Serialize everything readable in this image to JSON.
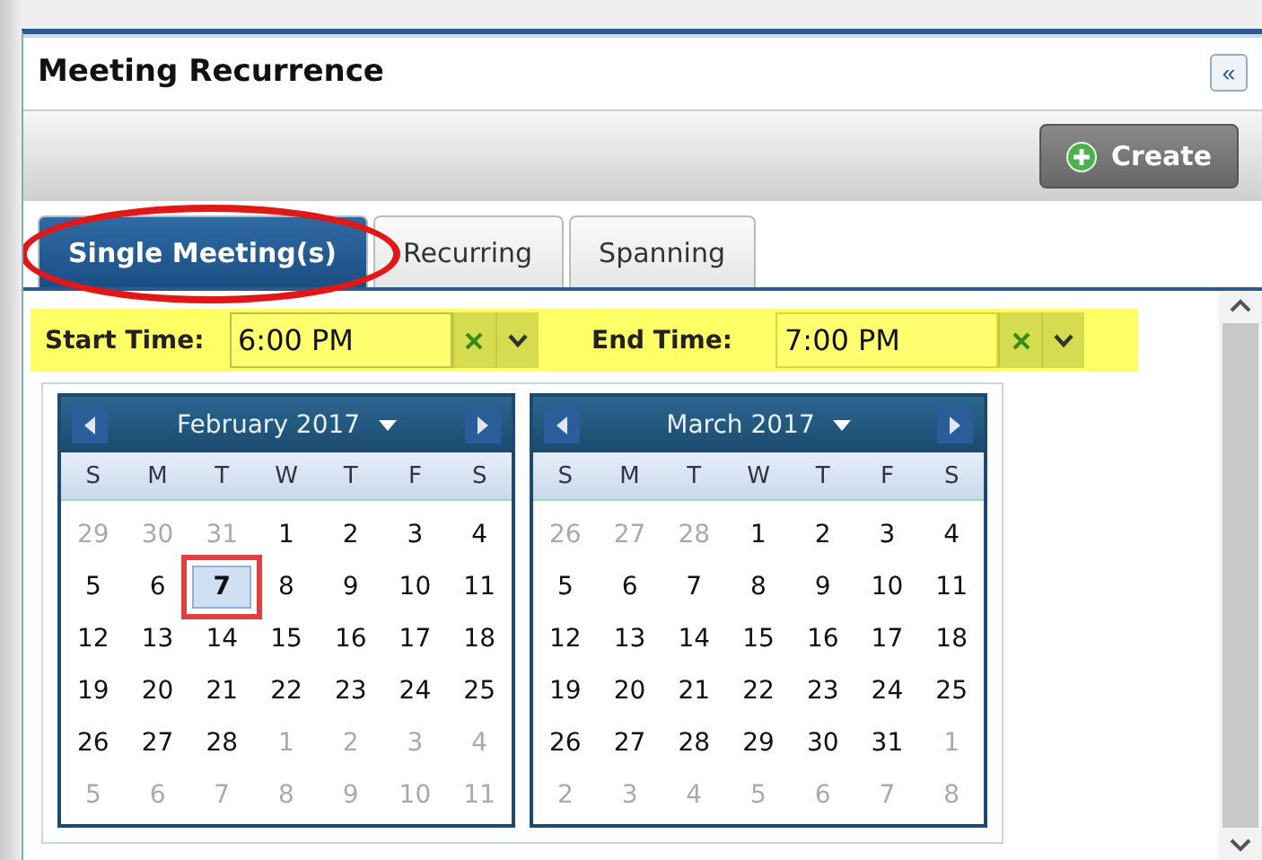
{
  "panel": {
    "title": "Meeting Recurrence",
    "collapse_icon": "«"
  },
  "toolbar": {
    "create_button": "Create"
  },
  "tabs": [
    {
      "label": "Single Meeting(s)",
      "selected": true,
      "annotated": true
    },
    {
      "label": "Recurring",
      "selected": false,
      "annotated": false
    },
    {
      "label": "Spanning",
      "selected": false,
      "annotated": false
    }
  ],
  "times": [
    {
      "label": "Start Time:",
      "value": "6:00 PM",
      "focused": true
    },
    {
      "label": "End Time:",
      "value": "7:00 PM",
      "focused": false
    }
  ],
  "calendars": [
    {
      "month": "February 2017",
      "weekdays": [
        "S",
        "M",
        "T",
        "W",
        "T",
        "F",
        "S"
      ],
      "weeks": [
        [
          {
            "d": "29",
            "outside": true,
            "selected": false
          },
          {
            "d": "30",
            "outside": true,
            "selected": false
          },
          {
            "d": "31",
            "outside": true,
            "selected": false
          },
          {
            "d": "1",
            "outside": false,
            "selected": false
          },
          {
            "d": "2",
            "outside": false,
            "selected": false
          },
          {
            "d": "3",
            "outside": false,
            "selected": false
          },
          {
            "d": "4",
            "outside": false,
            "selected": false
          }
        ],
        [
          {
            "d": "5",
            "outside": false,
            "selected": false
          },
          {
            "d": "6",
            "outside": false,
            "selected": false
          },
          {
            "d": "7",
            "outside": false,
            "selected": true
          },
          {
            "d": "8",
            "outside": false,
            "selected": false
          },
          {
            "d": "9",
            "outside": false,
            "selected": false
          },
          {
            "d": "10",
            "outside": false,
            "selected": false
          },
          {
            "d": "11",
            "outside": false,
            "selected": false
          }
        ],
        [
          {
            "d": "12",
            "outside": false,
            "selected": false
          },
          {
            "d": "13",
            "outside": false,
            "selected": false
          },
          {
            "d": "14",
            "outside": false,
            "selected": false
          },
          {
            "d": "15",
            "outside": false,
            "selected": false
          },
          {
            "d": "16",
            "outside": false,
            "selected": false
          },
          {
            "d": "17",
            "outside": false,
            "selected": false
          },
          {
            "d": "18",
            "outside": false,
            "selected": false
          }
        ],
        [
          {
            "d": "19",
            "outside": false,
            "selected": false
          },
          {
            "d": "20",
            "outside": false,
            "selected": false
          },
          {
            "d": "21",
            "outside": false,
            "selected": false
          },
          {
            "d": "22",
            "outside": false,
            "selected": false
          },
          {
            "d": "23",
            "outside": false,
            "selected": false
          },
          {
            "d": "24",
            "outside": false,
            "selected": false
          },
          {
            "d": "25",
            "outside": false,
            "selected": false
          }
        ],
        [
          {
            "d": "26",
            "outside": false,
            "selected": false
          },
          {
            "d": "27",
            "outside": false,
            "selected": false
          },
          {
            "d": "28",
            "outside": false,
            "selected": false
          },
          {
            "d": "1",
            "outside": true,
            "selected": false
          },
          {
            "d": "2",
            "outside": true,
            "selected": false
          },
          {
            "d": "3",
            "outside": true,
            "selected": false
          },
          {
            "d": "4",
            "outside": true,
            "selected": false
          }
        ],
        [
          {
            "d": "5",
            "outside": true,
            "selected": false
          },
          {
            "d": "6",
            "outside": true,
            "selected": false
          },
          {
            "d": "7",
            "outside": true,
            "selected": false
          },
          {
            "d": "8",
            "outside": true,
            "selected": false
          },
          {
            "d": "9",
            "outside": true,
            "selected": false
          },
          {
            "d": "10",
            "outside": true,
            "selected": false
          },
          {
            "d": "11",
            "outside": true,
            "selected": false
          }
        ]
      ]
    },
    {
      "month": "March 2017",
      "weekdays": [
        "S",
        "M",
        "T",
        "W",
        "T",
        "F",
        "S"
      ],
      "weeks": [
        [
          {
            "d": "26",
            "outside": true,
            "selected": false
          },
          {
            "d": "27",
            "outside": true,
            "selected": false
          },
          {
            "d": "28",
            "outside": true,
            "selected": false
          },
          {
            "d": "1",
            "outside": false,
            "selected": false
          },
          {
            "d": "2",
            "outside": false,
            "selected": false
          },
          {
            "d": "3",
            "outside": false,
            "selected": false
          },
          {
            "d": "4",
            "outside": false,
            "selected": false
          }
        ],
        [
          {
            "d": "5",
            "outside": false,
            "selected": false
          },
          {
            "d": "6",
            "outside": false,
            "selected": false
          },
          {
            "d": "7",
            "outside": false,
            "selected": false
          },
          {
            "d": "8",
            "outside": false,
            "selected": false
          },
          {
            "d": "9",
            "outside": false,
            "selected": false
          },
          {
            "d": "10",
            "outside": false,
            "selected": false
          },
          {
            "d": "11",
            "outside": false,
            "selected": false
          }
        ],
        [
          {
            "d": "12",
            "outside": false,
            "selected": false
          },
          {
            "d": "13",
            "outside": false,
            "selected": false
          },
          {
            "d": "14",
            "outside": false,
            "selected": false
          },
          {
            "d": "15",
            "outside": false,
            "selected": false
          },
          {
            "d": "16",
            "outside": false,
            "selected": false
          },
          {
            "d": "17",
            "outside": false,
            "selected": false
          },
          {
            "d": "18",
            "outside": false,
            "selected": false
          }
        ],
        [
          {
            "d": "19",
            "outside": false,
            "selected": false
          },
          {
            "d": "20",
            "outside": false,
            "selected": false
          },
          {
            "d": "21",
            "outside": false,
            "selected": false
          },
          {
            "d": "22",
            "outside": false,
            "selected": false
          },
          {
            "d": "23",
            "outside": false,
            "selected": false
          },
          {
            "d": "24",
            "outside": false,
            "selected": false
          },
          {
            "d": "25",
            "outside": false,
            "selected": false
          }
        ],
        [
          {
            "d": "26",
            "outside": false,
            "selected": false
          },
          {
            "d": "27",
            "outside": false,
            "selected": false
          },
          {
            "d": "28",
            "outside": false,
            "selected": false
          },
          {
            "d": "29",
            "outside": false,
            "selected": false
          },
          {
            "d": "30",
            "outside": false,
            "selected": false
          },
          {
            "d": "31",
            "outside": false,
            "selected": false
          },
          {
            "d": "1",
            "outside": true,
            "selected": false
          }
        ],
        [
          {
            "d": "2",
            "outside": true,
            "selected": false
          },
          {
            "d": "3",
            "outside": true,
            "selected": false
          },
          {
            "d": "4",
            "outside": true,
            "selected": false
          },
          {
            "d": "5",
            "outside": true,
            "selected": false
          },
          {
            "d": "6",
            "outside": true,
            "selected": false
          },
          {
            "d": "7",
            "outside": true,
            "selected": false
          },
          {
            "d": "8",
            "outside": true,
            "selected": false
          }
        ]
      ]
    }
  ]
}
